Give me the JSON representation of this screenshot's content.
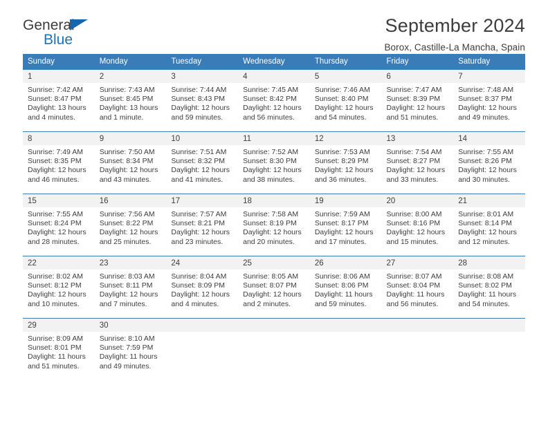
{
  "brand": {
    "name_part1": "General",
    "name_part2": "Blue",
    "triangle_color": "#1666ad",
    "blue_color": "#1673bf"
  },
  "header": {
    "title": "September 2024",
    "location": "Borox, Castille-La Mancha, Spain"
  },
  "theme": {
    "header_blue": "#3a7cb8",
    "daynum_bg": "#f2f2f2",
    "text": "#3d3d3d"
  },
  "weekdays": [
    "Sunday",
    "Monday",
    "Tuesday",
    "Wednesday",
    "Thursday",
    "Friday",
    "Saturday"
  ],
  "weeks": [
    [
      {
        "day": "1",
        "sunrise": "Sunrise: 7:42 AM",
        "sunset": "Sunset: 8:47 PM",
        "daylight1": "Daylight: 13 hours",
        "daylight2": "and 4 minutes."
      },
      {
        "day": "2",
        "sunrise": "Sunrise: 7:43 AM",
        "sunset": "Sunset: 8:45 PM",
        "daylight1": "Daylight: 13 hours",
        "daylight2": "and 1 minute."
      },
      {
        "day": "3",
        "sunrise": "Sunrise: 7:44 AM",
        "sunset": "Sunset: 8:43 PM",
        "daylight1": "Daylight: 12 hours",
        "daylight2": "and 59 minutes."
      },
      {
        "day": "4",
        "sunrise": "Sunrise: 7:45 AM",
        "sunset": "Sunset: 8:42 PM",
        "daylight1": "Daylight: 12 hours",
        "daylight2": "and 56 minutes."
      },
      {
        "day": "5",
        "sunrise": "Sunrise: 7:46 AM",
        "sunset": "Sunset: 8:40 PM",
        "daylight1": "Daylight: 12 hours",
        "daylight2": "and 54 minutes."
      },
      {
        "day": "6",
        "sunrise": "Sunrise: 7:47 AM",
        "sunset": "Sunset: 8:39 PM",
        "daylight1": "Daylight: 12 hours",
        "daylight2": "and 51 minutes."
      },
      {
        "day": "7",
        "sunrise": "Sunrise: 7:48 AM",
        "sunset": "Sunset: 8:37 PM",
        "daylight1": "Daylight: 12 hours",
        "daylight2": "and 49 minutes."
      }
    ],
    [
      {
        "day": "8",
        "sunrise": "Sunrise: 7:49 AM",
        "sunset": "Sunset: 8:35 PM",
        "daylight1": "Daylight: 12 hours",
        "daylight2": "and 46 minutes."
      },
      {
        "day": "9",
        "sunrise": "Sunrise: 7:50 AM",
        "sunset": "Sunset: 8:34 PM",
        "daylight1": "Daylight: 12 hours",
        "daylight2": "and 43 minutes."
      },
      {
        "day": "10",
        "sunrise": "Sunrise: 7:51 AM",
        "sunset": "Sunset: 8:32 PM",
        "daylight1": "Daylight: 12 hours",
        "daylight2": "and 41 minutes."
      },
      {
        "day": "11",
        "sunrise": "Sunrise: 7:52 AM",
        "sunset": "Sunset: 8:30 PM",
        "daylight1": "Daylight: 12 hours",
        "daylight2": "and 38 minutes."
      },
      {
        "day": "12",
        "sunrise": "Sunrise: 7:53 AM",
        "sunset": "Sunset: 8:29 PM",
        "daylight1": "Daylight: 12 hours",
        "daylight2": "and 36 minutes."
      },
      {
        "day": "13",
        "sunrise": "Sunrise: 7:54 AM",
        "sunset": "Sunset: 8:27 PM",
        "daylight1": "Daylight: 12 hours",
        "daylight2": "and 33 minutes."
      },
      {
        "day": "14",
        "sunrise": "Sunrise: 7:55 AM",
        "sunset": "Sunset: 8:26 PM",
        "daylight1": "Daylight: 12 hours",
        "daylight2": "and 30 minutes."
      }
    ],
    [
      {
        "day": "15",
        "sunrise": "Sunrise: 7:55 AM",
        "sunset": "Sunset: 8:24 PM",
        "daylight1": "Daylight: 12 hours",
        "daylight2": "and 28 minutes."
      },
      {
        "day": "16",
        "sunrise": "Sunrise: 7:56 AM",
        "sunset": "Sunset: 8:22 PM",
        "daylight1": "Daylight: 12 hours",
        "daylight2": "and 25 minutes."
      },
      {
        "day": "17",
        "sunrise": "Sunrise: 7:57 AM",
        "sunset": "Sunset: 8:21 PM",
        "daylight1": "Daylight: 12 hours",
        "daylight2": "and 23 minutes."
      },
      {
        "day": "18",
        "sunrise": "Sunrise: 7:58 AM",
        "sunset": "Sunset: 8:19 PM",
        "daylight1": "Daylight: 12 hours",
        "daylight2": "and 20 minutes."
      },
      {
        "day": "19",
        "sunrise": "Sunrise: 7:59 AM",
        "sunset": "Sunset: 8:17 PM",
        "daylight1": "Daylight: 12 hours",
        "daylight2": "and 17 minutes."
      },
      {
        "day": "20",
        "sunrise": "Sunrise: 8:00 AM",
        "sunset": "Sunset: 8:16 PM",
        "daylight1": "Daylight: 12 hours",
        "daylight2": "and 15 minutes."
      },
      {
        "day": "21",
        "sunrise": "Sunrise: 8:01 AM",
        "sunset": "Sunset: 8:14 PM",
        "daylight1": "Daylight: 12 hours",
        "daylight2": "and 12 minutes."
      }
    ],
    [
      {
        "day": "22",
        "sunrise": "Sunrise: 8:02 AM",
        "sunset": "Sunset: 8:12 PM",
        "daylight1": "Daylight: 12 hours",
        "daylight2": "and 10 minutes."
      },
      {
        "day": "23",
        "sunrise": "Sunrise: 8:03 AM",
        "sunset": "Sunset: 8:11 PM",
        "daylight1": "Daylight: 12 hours",
        "daylight2": "and 7 minutes."
      },
      {
        "day": "24",
        "sunrise": "Sunrise: 8:04 AM",
        "sunset": "Sunset: 8:09 PM",
        "daylight1": "Daylight: 12 hours",
        "daylight2": "and 4 minutes."
      },
      {
        "day": "25",
        "sunrise": "Sunrise: 8:05 AM",
        "sunset": "Sunset: 8:07 PM",
        "daylight1": "Daylight: 12 hours",
        "daylight2": "and 2 minutes."
      },
      {
        "day": "26",
        "sunrise": "Sunrise: 8:06 AM",
        "sunset": "Sunset: 8:06 PM",
        "daylight1": "Daylight: 11 hours",
        "daylight2": "and 59 minutes."
      },
      {
        "day": "27",
        "sunrise": "Sunrise: 8:07 AM",
        "sunset": "Sunset: 8:04 PM",
        "daylight1": "Daylight: 11 hours",
        "daylight2": "and 56 minutes."
      },
      {
        "day": "28",
        "sunrise": "Sunrise: 8:08 AM",
        "sunset": "Sunset: 8:02 PM",
        "daylight1": "Daylight: 11 hours",
        "daylight2": "and 54 minutes."
      }
    ],
    [
      {
        "day": "29",
        "sunrise": "Sunrise: 8:09 AM",
        "sunset": "Sunset: 8:01 PM",
        "daylight1": "Daylight: 11 hours",
        "daylight2": "and 51 minutes."
      },
      {
        "day": "30",
        "sunrise": "Sunrise: 8:10 AM",
        "sunset": "Sunset: 7:59 PM",
        "daylight1": "Daylight: 11 hours",
        "daylight2": "and 49 minutes."
      },
      {
        "day": "",
        "sunrise": "",
        "sunset": "",
        "daylight1": "",
        "daylight2": ""
      },
      {
        "day": "",
        "sunrise": "",
        "sunset": "",
        "daylight1": "",
        "daylight2": ""
      },
      {
        "day": "",
        "sunrise": "",
        "sunset": "",
        "daylight1": "",
        "daylight2": ""
      },
      {
        "day": "",
        "sunrise": "",
        "sunset": "",
        "daylight1": "",
        "daylight2": ""
      },
      {
        "day": "",
        "sunrise": "",
        "sunset": "",
        "daylight1": "",
        "daylight2": ""
      }
    ]
  ]
}
